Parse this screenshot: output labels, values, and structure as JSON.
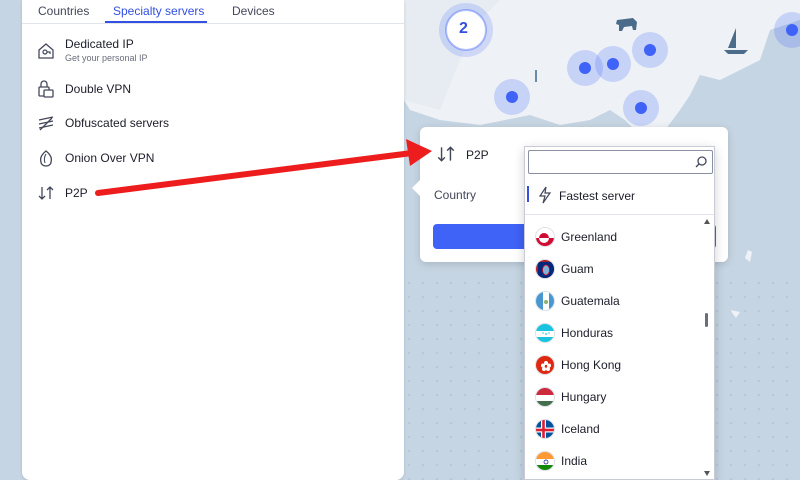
{
  "tabs": {
    "countries": "Countries",
    "specialty": "Specialty servers",
    "devices": "Devices",
    "active": "specialty"
  },
  "menu": {
    "dedicated_ip": {
      "label": "Dedicated IP",
      "sub": "Get your personal IP",
      "icon": "home-key-icon"
    },
    "double_vpn": {
      "label": "Double VPN",
      "icon": "double-lock-icon"
    },
    "obfuscated": {
      "label": "Obfuscated servers",
      "icon": "obfuscated-icon"
    },
    "onion": {
      "label": "Onion Over VPN",
      "icon": "onion-icon"
    },
    "p2p": {
      "label": "P2P",
      "icon": "p2p-arrows-icon"
    }
  },
  "map": {
    "cluster_count": "2"
  },
  "card": {
    "title": "P2P",
    "country_label": "Country"
  },
  "dropdown": {
    "search_placeholder": "",
    "fastest_label": "Fastest server",
    "countries": [
      "Greenland",
      "Guam",
      "Guatemala",
      "Honduras",
      "Hong Kong",
      "Hungary",
      "Iceland",
      "India"
    ]
  },
  "colors": {
    "accent": "#3350e0",
    "button": "#3f62f7",
    "map_sea": "#c6d5e3",
    "map_land": "#eef2f6",
    "marker": "#3f62f7",
    "annotation": "#ee1d1d"
  }
}
